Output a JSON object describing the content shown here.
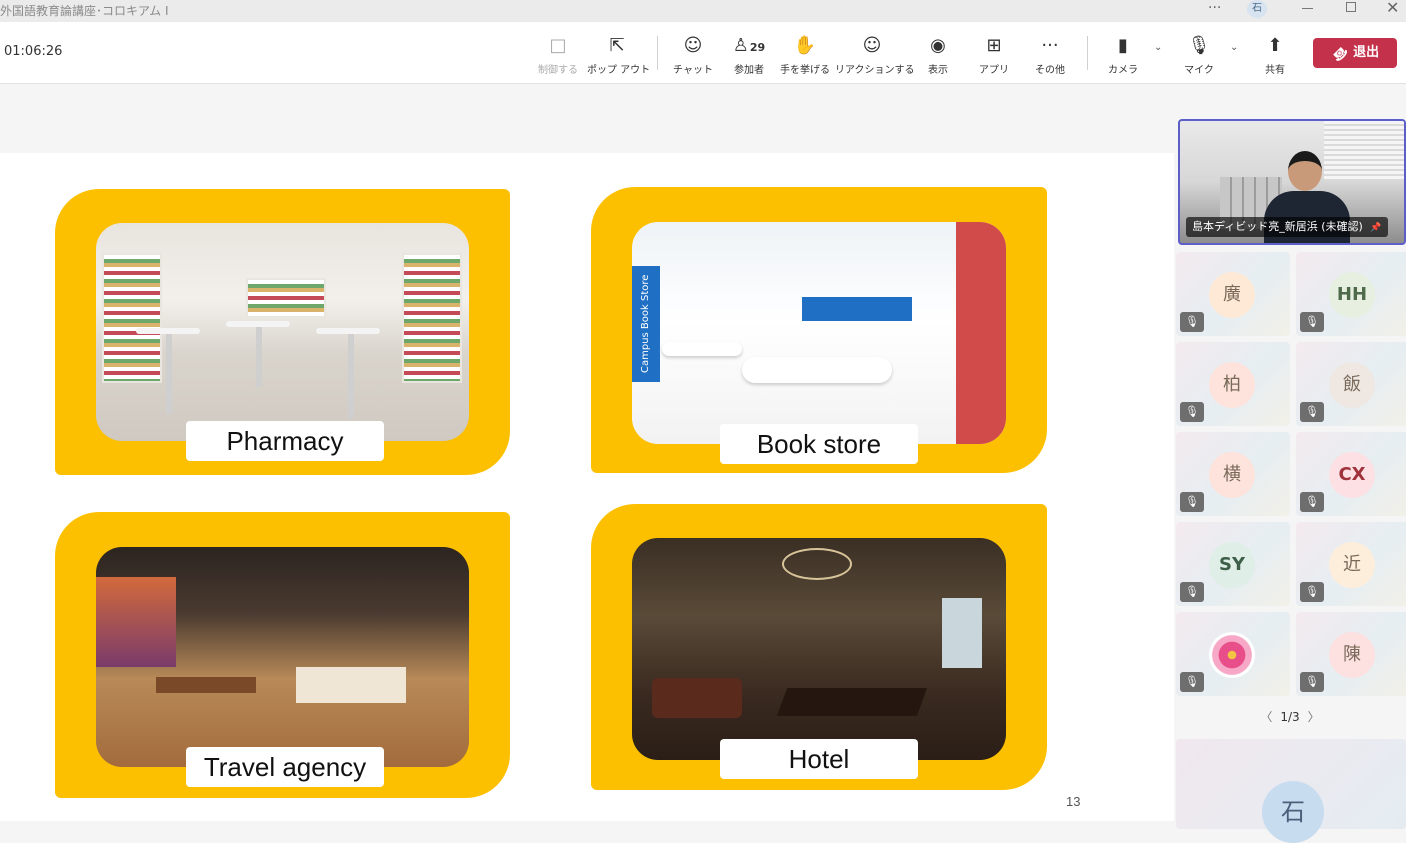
{
  "window": {
    "title": "外国語教育論講座･コロキアム I",
    "more_label": "···",
    "user_initial": "石",
    "close_label": "✕"
  },
  "toolbar": {
    "timer": "01:06:26",
    "buttons": {
      "control": {
        "label": "制御する",
        "icon": "□"
      },
      "popout": {
        "label": "ポップ アウト",
        "icon": "⇱"
      },
      "chat": {
        "label": "チャット",
        "icon": "☺"
      },
      "people": {
        "label": "参加者",
        "icon": "♙",
        "count": "29"
      },
      "raise_hand": {
        "label": "手を挙げる",
        "icon": "✋"
      },
      "react": {
        "label": "リアクションする",
        "icon": "☺"
      },
      "view": {
        "label": "表示",
        "icon": "◉"
      },
      "apps": {
        "label": "アプリ",
        "icon": "⊞"
      },
      "more": {
        "label": "その他",
        "icon": "···"
      },
      "camera": {
        "label": "カメラ",
        "icon": "▮"
      },
      "mic": {
        "label": "マイク",
        "icon": "🎙"
      },
      "share": {
        "label": "共有",
        "icon": "⬆"
      }
    },
    "chevron": "⌄",
    "leave_label": "退出",
    "leave_icon": "☎",
    "leave_color": "#c4314b"
  },
  "slide": {
    "accent": "#fcc000",
    "cards": [
      {
        "caption": "Pharmacy",
        "scene": "pharmacy"
      },
      {
        "caption": "Book store",
        "scene": "bookstore"
      },
      {
        "caption": "Travel agency",
        "scene": "travel"
      },
      {
        "caption": "Hotel",
        "scene": "hotel"
      }
    ],
    "store_sign": "Campus Book Store",
    "page_number": "13"
  },
  "sidebar": {
    "self_view_name": "島本ディビッド亮_新居浜 (未確認)",
    "pin_icon": "📌",
    "participants": [
      {
        "initial": "廣",
        "color": "#fde9d6"
      },
      {
        "initial": "HH",
        "color": "#e6efe0"
      },
      {
        "initial": "柏",
        "color": "#fde3dc"
      },
      {
        "initial": "飯",
        "color": "#eee7e2"
      },
      {
        "initial": "横",
        "color": "#fde3dc"
      },
      {
        "initial": "CX",
        "color": "#fde0e4"
      },
      {
        "initial": "SY",
        "color": "#dfeee6"
      },
      {
        "initial": "近",
        "color": "#fdeedc"
      },
      {
        "initial": "",
        "color": "#ffffff"
      },
      {
        "initial": "陳",
        "color": "#fde0e0"
      }
    ],
    "mic_off_icon": "🎙",
    "pager": {
      "prev": "〈",
      "label": "1/3",
      "next": "〉"
    },
    "bottom_initial": "石"
  }
}
